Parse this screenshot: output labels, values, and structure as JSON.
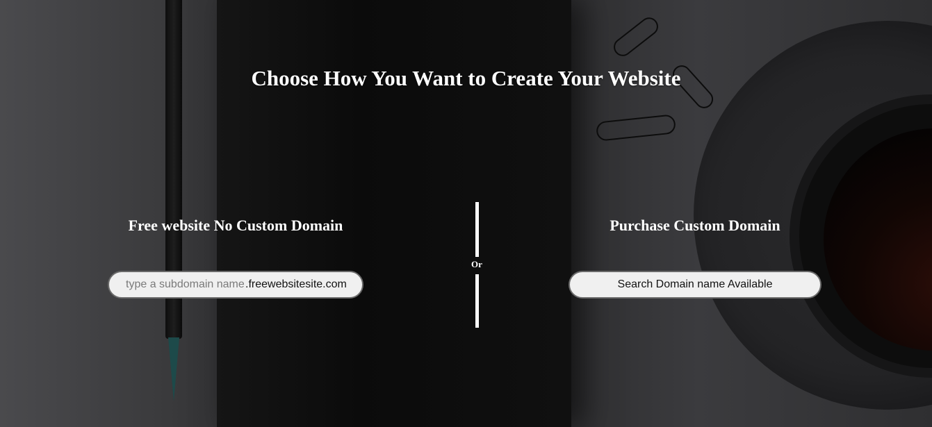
{
  "page": {
    "title": "Choose How You Want to Create Your Website"
  },
  "free_option": {
    "heading": "Free website No Custom Domain",
    "subdomain_placeholder": "type a subdomain name",
    "domain_suffix": ".freewebsitesite.com",
    "subdomain_value": ""
  },
  "separator": {
    "label": "Or"
  },
  "custom_option": {
    "heading": "Purchase Custom Domain",
    "search_button_label": "Search Domain name Available"
  },
  "colors": {
    "text": "#ffffff",
    "field_background": "#f0f0f0",
    "field_border": "#6a6a6a",
    "background": "#2b2b2d"
  }
}
